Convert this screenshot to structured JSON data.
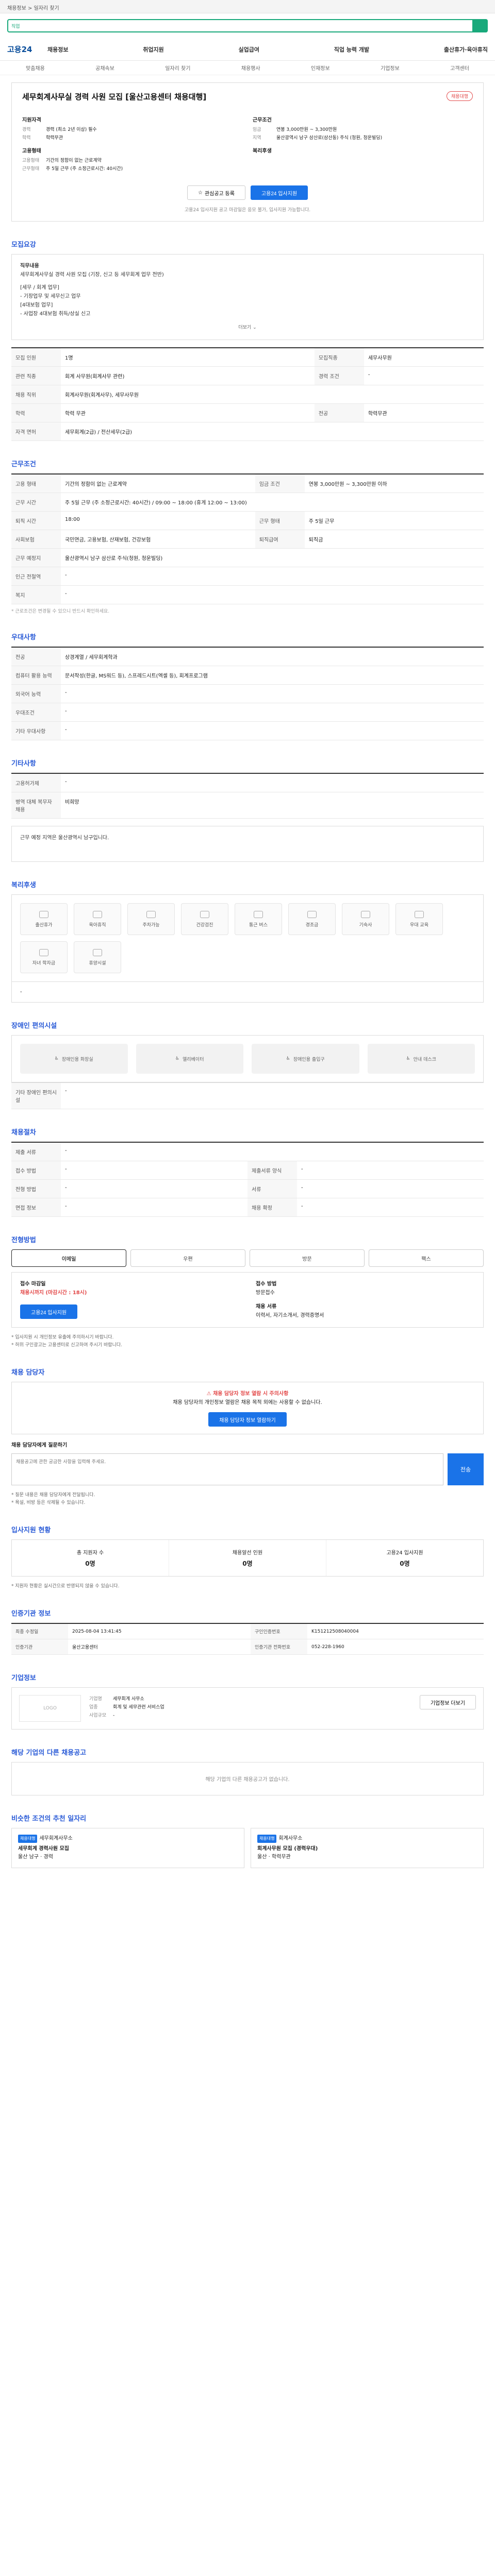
{
  "topbar": {
    "text": "채용정보 > 일자리 찾기"
  },
  "search": {
    "tag": "직업",
    "placeholder": ""
  },
  "gnb": {
    "logo": "고용24",
    "menu": [
      "채용정보",
      "취업지원",
      "실업급여",
      "직업 능력 개발",
      "출산휴가·육아휴직"
    ]
  },
  "subnav": [
    "맞춤채용",
    "공채속보",
    "일자리 찾기",
    "채용행사",
    "인재정보",
    "기업정보",
    "고객센터"
  ],
  "job": {
    "title": "세무회계사무실 경력 사원 모집 [울산고용센터 채용대행]",
    "badge": "채용대행",
    "apply_title": "지원자격",
    "apply_rows": [
      {
        "k": "경력",
        "v": "경력 (최소 2년 이상) 필수"
      },
      {
        "k": "학력",
        "v": "학력무관"
      }
    ],
    "work_title": "근무조건",
    "work_rows": [
      {
        "k": "임금",
        "v": "연봉 3,000만원 ~ 3,300만원"
      },
      {
        "k": "지역",
        "v": "울산광역시 남구 삼산로(삼산동) 주식 (청원, 청운빌딩)"
      }
    ],
    "emp_title": "고용형태",
    "emp_rows": [
      {
        "k": "고용형태",
        "v": "기간의 정함이 없는 근로계약"
      },
      {
        "k": "근무형태",
        "v": "주 5일 근무 (주 소정근로시간: 40시간)"
      }
    ],
    "welfare_title": "복리후생",
    "btn_scrap": "관심공고 등록",
    "btn_apply": "고용24 입사지원",
    "notice": "고용24 입사지원 공고 마감일은 응모 불가, 입사지원 가능합니다."
  },
  "recruit": {
    "title": "모집요강",
    "job_desc_heading": "직무내용",
    "job_desc": "세무회계사무실 경력 사원 모집 (기장, 신고 등 세무회계 업무 전반)",
    "job_desc_more": [
      "[세무 / 회계 업무]",
      "- 기장업무 및 세무신고 업무",
      "[4대보험 업무]",
      "- 사업장 4대보험 취득/상실 신고"
    ],
    "more": "더보기",
    "rows": [
      {
        "k": "모집 인원",
        "v": "1명",
        "k2": "모집직종",
        "v2": "세무사무원"
      },
      {
        "k": "관련 직종",
        "v": "회계 사무원(회계사무 관련)",
        "k2": "경력 조건",
        "v2": "-"
      },
      {
        "k": "채용 직위",
        "v": "회계사무원(회계사무), 세무사무원",
        "k2": "",
        "v2": ""
      },
      {
        "k": "학력",
        "v": "학력 무관",
        "k2": "전공",
        "v2": "학력무관"
      },
      {
        "k": "자격 면허",
        "v": "세무회계(2급) / 전산세무(2급)",
        "k2": "",
        "v2": ""
      }
    ]
  },
  "work": {
    "title": "근무조건",
    "rows": [
      {
        "k": "고용 형태",
        "v": "기간의 정함이 없는 근로계약",
        "k2": "임금 조건",
        "v2": "연봉 3,000만원 ~ 3,300만원 이하"
      },
      {
        "k": "근무 시간",
        "v": "주 5일 근무 (주 소정근로시간: 40시간) / 09:00 ~ 18:00 (휴게 12:00 ~ 13:00)",
        "k2": "",
        "v2": ""
      },
      {
        "k": "퇴직 시간",
        "v": "18:00",
        "k2": "근무 형태",
        "v2": "주 5일 근무"
      },
      {
        "k": "사회보험",
        "v": "국민연금, 고용보험, 산재보험, 건강보험",
        "k2": "퇴직급여",
        "v2": "퇴직금"
      },
      {
        "k": "근무 예정지",
        "v": "울산광역시 남구 삼산로 주식(청원, 청운빌딩)",
        "k2": "",
        "v2": ""
      },
      {
        "k": "인근 전철역",
        "v": "-",
        "k2": "",
        "v2": ""
      },
      {
        "k": "복지",
        "v": "-",
        "k2": "",
        "v2": ""
      }
    ],
    "note": "* 근로조건은 변경될 수 있으니 반드시 확인하세요."
  },
  "prefer": {
    "title": "우대사항",
    "rows": [
      {
        "k": "전공",
        "v": "상경계열 / 세무회계학과"
      },
      {
        "k": "컴퓨터 활용 능력",
        "v": "문서작성(한글, MS워드 등), 스프레드시트(엑셀 등), 회계프로그램"
      },
      {
        "k": "외국어 능력",
        "v": "-"
      },
      {
        "k": "우대조건",
        "v": "-"
      },
      {
        "k": "기타 우대사항",
        "v": "-"
      }
    ]
  },
  "etc": {
    "title": "기타사항",
    "rows": [
      {
        "k": "고용허가제",
        "v": "-"
      },
      {
        "k": "병역 대체 복무자 채용",
        "v": "비희망"
      }
    ],
    "extra": [
      "근무 예정 지역은 울산광역시 남구입니다."
    ]
  },
  "welfare": {
    "title": "복리후생",
    "items": [
      "출산휴가",
      "육아휴직",
      "주차가능",
      "건강검진",
      "통근 버스",
      "경조금",
      "기숙사",
      "우대 교육",
      "자녀 학자금",
      "휴양시설"
    ]
  },
  "disability": {
    "title": "장애인 편의시설",
    "items": [
      "장애인용 화장실",
      "엘리베이터",
      "장애인용 출입구",
      "안내 데스크"
    ],
    "row_k": "기타 장애인 편의시설",
    "row_v": "-"
  },
  "agency": {
    "title": "채용절차",
    "rows": [
      {
        "k": "제출 서류",
        "v": "-",
        "k2": "",
        "v2": ""
      },
      {
        "k": "접수 방법",
        "v": "-",
        "k2": "제출서류 양식",
        "v2": "-"
      },
      {
        "k": "전형 방법",
        "v": "-",
        "k2": "서류",
        "v2": "-"
      },
      {
        "k": "면접 정보",
        "v": "-",
        "k2": "채용 확정",
        "v2": "-"
      }
    ]
  },
  "apply": {
    "title": "전형방법",
    "tabs": [
      "이메일",
      "우편",
      "방문",
      "팩스"
    ],
    "col1_h": "접수 마감일",
    "col1_v": "채용시까지 (마감시간 : 18시)",
    "col1_btn": "고용24 입사지원",
    "col2_h": "접수 방법",
    "col2_v": "방문접수",
    "col3_h": "채용 서류",
    "col3_v": "이력서, 자기소개서, 경력증명서",
    "bullets": [
      "* 입사지원 시 개인정보 유출에 주의하시기 바랍니다.",
      "* 허위 구인광고는 고용센터로 신고하여 주시기 바랍니다."
    ]
  },
  "manager": {
    "title": "채용 담당자",
    "alert_title": "채용 담당자 정보 열람 시 주의사항",
    "alert_body": "채용 담당자의 개인정보 열람은 채용 목적 외에는 사용할 수 없습니다.",
    "btn_view": "채용 담당자 정보 열람하기",
    "inquiry_label": "채용 담당자에게 질문하기",
    "inquiry_placeholder": "채용공고에 관한 궁금한 사항을 입력해 주세요.",
    "send": "전송",
    "bullets": [
      "* 질문 내용은 채용 담당자에게 전달됩니다.",
      "* 욕설, 비방 등은 삭제될 수 있습니다."
    ]
  },
  "status": {
    "title": "입사지원 현황",
    "items": [
      {
        "k": "총 지원자 수",
        "v": "0명"
      },
      {
        "k": "채용알선 인원",
        "v": "0명"
      },
      {
        "k": "고용24 입사지원",
        "v": "0명"
      }
    ],
    "note": "* 지원자 현황은 실시간으로 반영되지 않을 수 있습니다."
  },
  "meta": {
    "title": "인증기관 정보",
    "rows": [
      {
        "k": "최종 수정일",
        "v": "2025-08-04 13:41:45",
        "k2": "구인인증번호",
        "v2": "K151212508040004"
      },
      {
        "k": "인증기관",
        "v": "울산고용센터",
        "k2": "인증기관 전화번호",
        "v2": "052-228-1960"
      }
    ]
  },
  "company": {
    "title": "기업정보",
    "logo": "LOGO",
    "rows": [
      {
        "k": "기업명",
        "v": "세무회계 사무소"
      },
      {
        "k": "업종",
        "v": "회계 및 세무관련 서비스업"
      },
      {
        "k": "사업규모",
        "v": "-"
      }
    ],
    "btn": "기업정보 더보기"
  },
  "other": {
    "title": "해당 기업의 다른 채용공고",
    "empty": "해당 기업의 다른 채용공고가 없습니다."
  },
  "similar": {
    "title": "비슷한 조건의 추천 일자리",
    "cards": [
      {
        "tag": "채용대행",
        "company": "세무회계사무소",
        "title": "세무회계 경력사원 모집",
        "meta": "울산 남구 · 경력"
      },
      {
        "tag": "채용대행",
        "company": "회계사무소",
        "title": "회계사무원 모집 (경력우대)",
        "meta": "울산 · 학력무관"
      }
    ]
  }
}
